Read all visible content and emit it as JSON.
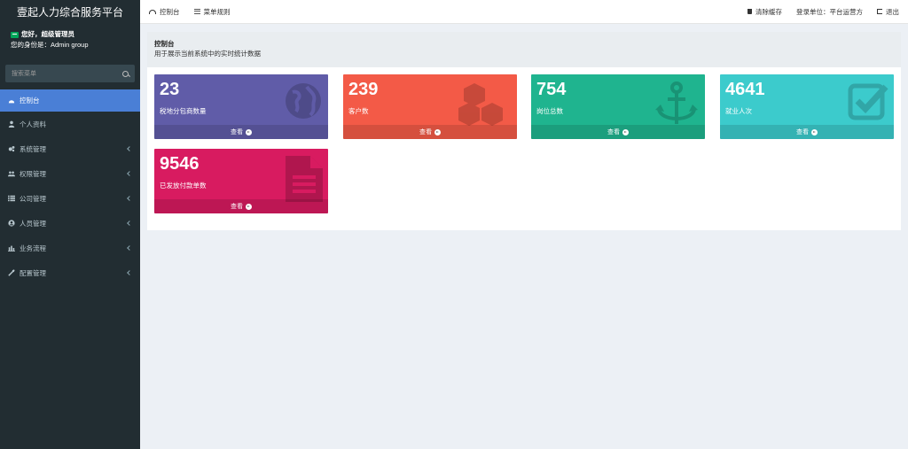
{
  "sidebar": {
    "brand": "壹起人力综合服务平台",
    "user": {
      "greeting": "您好，超级管理员",
      "role": "您的身份是：Admin group"
    },
    "search_placeholder": "搜索菜单",
    "items": [
      {
        "label": "控制台",
        "icon": "dashboard-icon",
        "active": true
      },
      {
        "label": "个人资料",
        "icon": "user-icon"
      },
      {
        "label": "系统管理",
        "icon": "cogs-icon",
        "expandable": true
      },
      {
        "label": "权限管理",
        "icon": "users-icon",
        "expandable": true
      },
      {
        "label": "公司管理",
        "icon": "list-icon",
        "expandable": true
      },
      {
        "label": "人员管理",
        "icon": "user-circle-icon",
        "expandable": true
      },
      {
        "label": "业务流程",
        "icon": "bar-chart-icon",
        "expandable": true
      },
      {
        "label": "配置管理",
        "icon": "wrench-icon",
        "expandable": true
      }
    ]
  },
  "header": {
    "tabs": [
      {
        "label": "控制台",
        "icon": "dashboard-icon"
      },
      {
        "label": "菜单规则",
        "icon": "list-icon"
      }
    ],
    "clear_cache": "清除缓存",
    "login_unit": "登录单位：平台运营方",
    "logout": "退出"
  },
  "page": {
    "title": "控制台",
    "description": "用于展示当前系统中的实时统计数据"
  },
  "stats": [
    {
      "value": "23",
      "label": "税地分包商数量",
      "link": "查看",
      "color": "#605ca8",
      "icon": "globe-icon"
    },
    {
      "value": "239",
      "label": "客户数",
      "link": "查看",
      "color": "#f35a47",
      "icon": "cubes-icon"
    },
    {
      "value": "754",
      "label": "岗位总数",
      "link": "查看",
      "color": "#1fb48f",
      "icon": "anchor-icon"
    },
    {
      "value": "4641",
      "label": "就业人次",
      "link": "查看",
      "color": "#3ccbcc",
      "icon": "check-square-icon"
    },
    {
      "value": "9546",
      "label": "已发放付款单数",
      "link": "查看",
      "color": "#d81b60",
      "icon": "file-text-icon"
    }
  ]
}
